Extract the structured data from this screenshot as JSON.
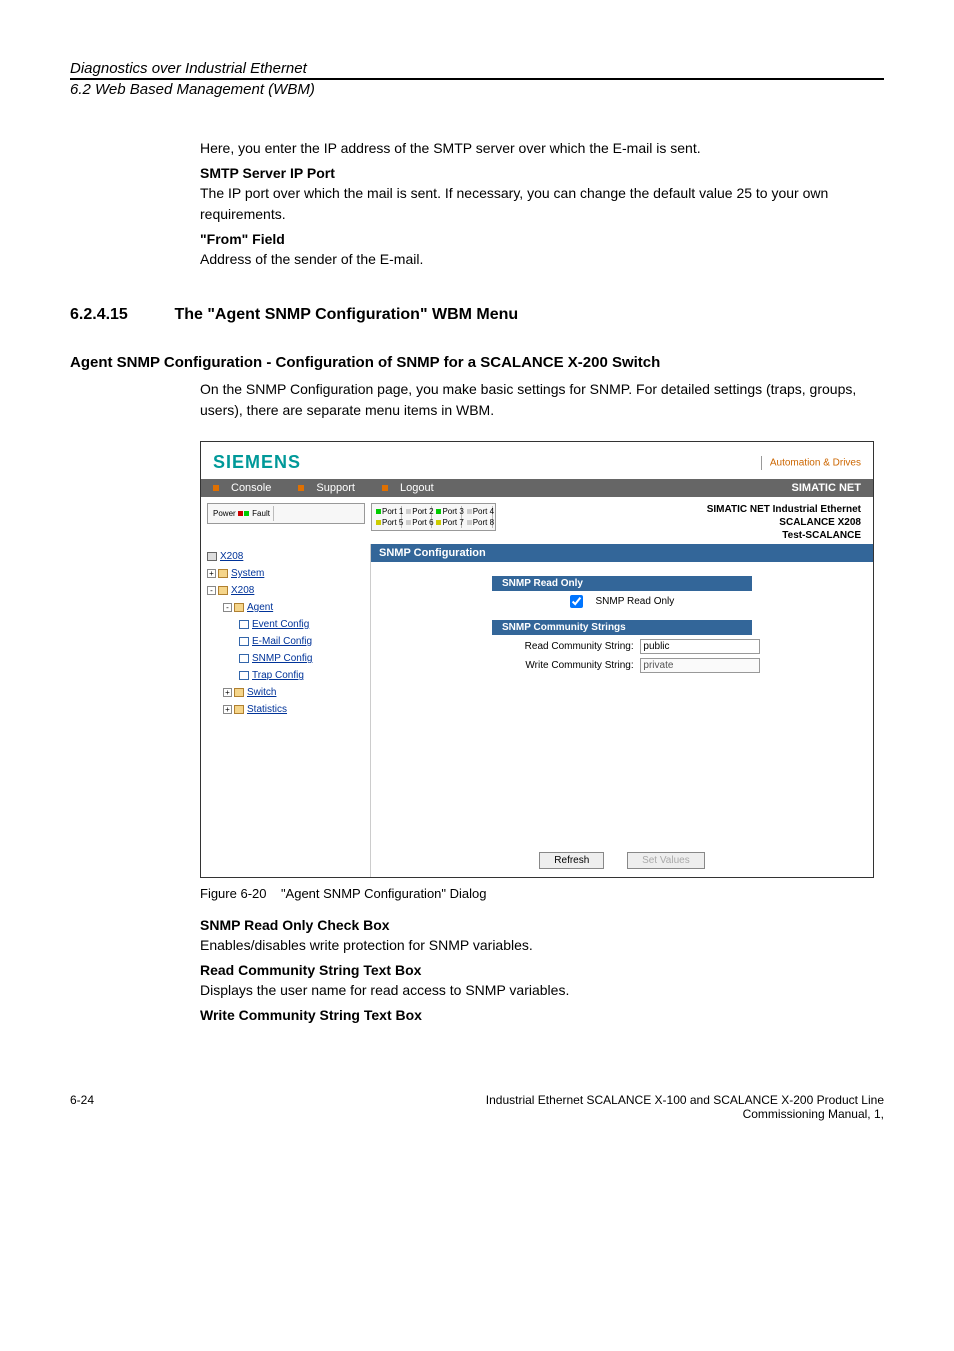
{
  "header": {
    "line1": "Diagnostics over Industrial Ethernet",
    "line2": "6.2 Web Based Management (WBM)"
  },
  "intro": {
    "p1": "Here, you enter the IP address of the SMTP server over which the E-mail is sent.",
    "h1": "SMTP Server IP Port",
    "p2": "The IP port over which the mail is sent. If necessary, you can change the default value 25 to your own requirements.",
    "h2": "\"From\" Field",
    "p3": "Address of the sender of the E-mail."
  },
  "section": {
    "num": "6.2.4.15",
    "title": "The \"Agent SNMP Configuration\" WBM Menu"
  },
  "subsection": {
    "title": "Agent SNMP Configuration - Configuration of SNMP for a SCALANCE X-200 Switch",
    "p1": "On the SNMP Configuration page, you make basic settings for SNMP. For detailed settings (traps, groups, users), there are separate menu items in WBM."
  },
  "screenshot": {
    "siemens": "SIEMENS",
    "ad": "Automation & Drives",
    "menu": {
      "console": "Console",
      "support": "Support",
      "logout": "Logout",
      "simatic": "SIMATIC NET"
    },
    "ports": {
      "power": "Power",
      "fault": "Fault",
      "p1": "Port 1",
      "p2": "Port 2",
      "p3": "Port 3",
      "p4": "Port 4",
      "p5": "Port 5",
      "p6": "Port 6",
      "p7": "Port 7",
      "p8": "Port 8"
    },
    "topright": {
      "l1": "SIMATIC NET Industrial Ethernet",
      "l2": "SCALANCE X208",
      "l3": "Test-SCALANCE"
    },
    "tree": {
      "root": "X208",
      "system": "System",
      "x208": "X208",
      "agent": "Agent",
      "event": "Event Config",
      "email": "E-Mail Config",
      "snmp": "SNMP Config",
      "trap": "Trap Config",
      "switch": "Switch",
      "statistics": "Statistics"
    },
    "panel": {
      "title": "SNMP Configuration",
      "group1": "SNMP Read Only",
      "cb_label": "SNMP Read Only",
      "group2": "SNMP Community Strings",
      "read_label": "Read Community String:",
      "read_value": "public",
      "write_label": "Write Community String:",
      "write_value": "private",
      "refresh": "Refresh",
      "set": "Set Values"
    }
  },
  "figcaption": {
    "num": "Figure 6-20",
    "text": "\"Agent SNMP Configuration\" Dialog"
  },
  "tail": {
    "h1": "SNMP Read Only Check Box",
    "p1": "Enables/disables write protection for SNMP variables.",
    "h2": "Read Community String Text Box",
    "p2": "Displays the user name for read access to SNMP variables.",
    "h3": "Write Community String Text Box"
  },
  "footer": {
    "left": "6-24",
    "r1": "Industrial Ethernet SCALANCE X-100 and SCALANCE X-200 Product Line",
    "r2": "Commissioning Manual, 1,"
  }
}
